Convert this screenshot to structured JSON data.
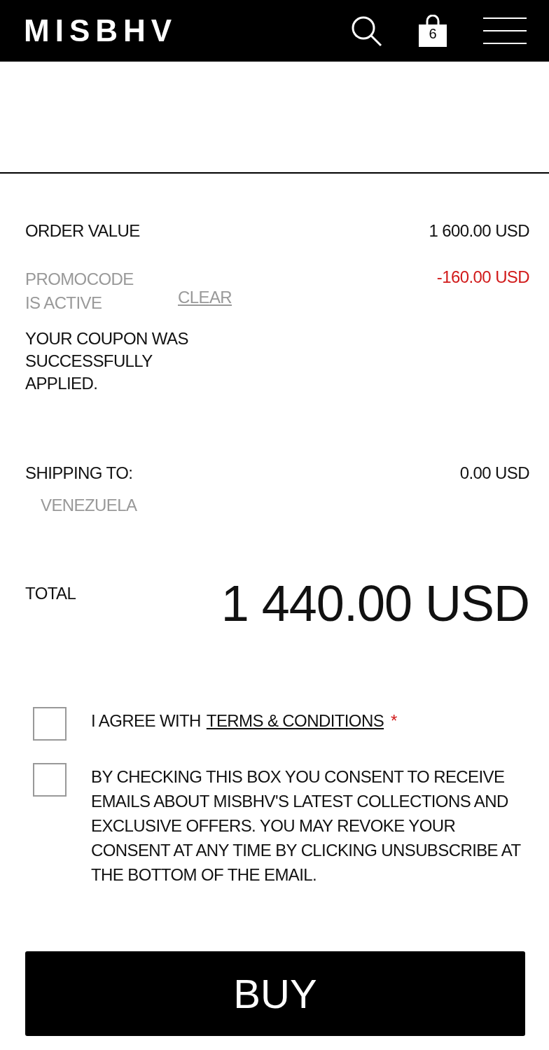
{
  "header": {
    "logo": "MISBHV",
    "cart_count": "6"
  },
  "summary": {
    "order_value": {
      "label": "ORDER VALUE",
      "value": "1 600.00 USD"
    },
    "promo": {
      "label": "PROMOCODE IS ACTIVE",
      "action": "CLEAR",
      "discount": "-160.00 USD"
    },
    "coupon_message": "YOUR COUPON WAS SUCCESSFULLY APPLIED.",
    "shipping": {
      "label": "SHIPPING TO:",
      "country": "VENEZUELA",
      "value": "0.00 USD"
    },
    "total": {
      "label": "TOTAL",
      "value": "1 440.00 USD"
    }
  },
  "consents": [
    {
      "kind": "terms",
      "text": "I AGREE WITH",
      "link": "TERMS & CONDITIONS",
      "required_mark": "*",
      "checked": false
    },
    {
      "kind": "plain",
      "text": "BY CHECKING THIS BOX YOU CONSENT TO RECEIVE EMAILS ABOUT MISBHV'S LATEST COLLECTIONS AND EXCLUSIVE OFFERS. YOU MAY REVOKE YOUR CONSENT AT ANY TIME BY CLICKING UNSUBSCRIBE AT THE BOTTOM OF THE EMAIL.",
      "checked": false
    }
  ],
  "buy_button": "BUY"
}
